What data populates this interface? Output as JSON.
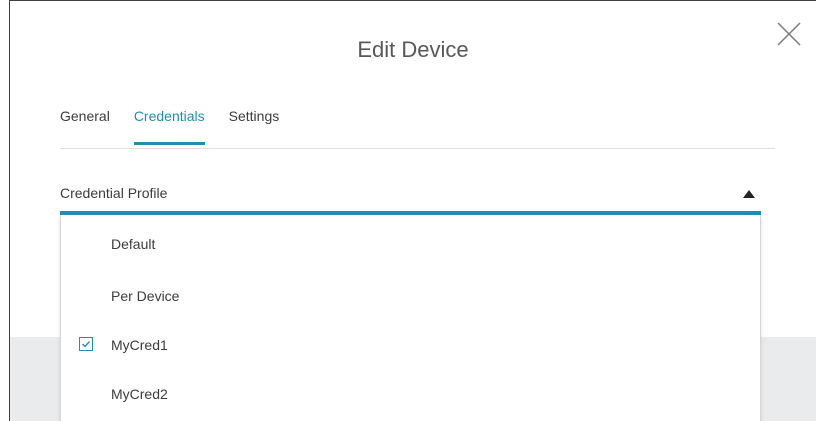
{
  "dialog": {
    "title": "Edit Device",
    "close_icon": "close-icon"
  },
  "tabs": [
    {
      "label": "General",
      "active": false
    },
    {
      "label": "Credentials",
      "active": true
    },
    {
      "label": "Settings",
      "active": false
    }
  ],
  "credential_profile": {
    "label": "Credential Profile",
    "caret_icon": "caret-up-icon",
    "expanded": true
  },
  "options": [
    {
      "label": "Default",
      "checked": false
    },
    {
      "label": "Per Device",
      "checked": false
    },
    {
      "label": "MyCred1",
      "checked": true
    },
    {
      "label": "MyCred2",
      "checked": false
    }
  ],
  "colors": {
    "accent": "#1f8eb3",
    "text": "#3c3c3c",
    "title": "#58585b",
    "footer": "#eaebec"
  }
}
